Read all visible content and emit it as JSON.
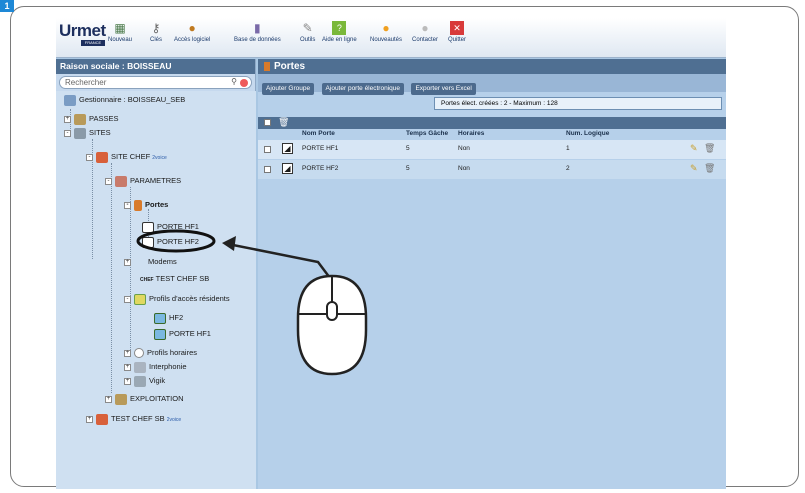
{
  "figure_label": "1",
  "logo": {
    "brand": "Urmet",
    "sub": "FRANCE"
  },
  "toolbar": [
    {
      "label": "Nouveau",
      "icon": "new-icon"
    },
    {
      "label": "Clés",
      "icon": "keys-icon"
    },
    {
      "label": "Accès logiciel",
      "icon": "users-icon"
    },
    {
      "label": "Base de données",
      "icon": "database-icon"
    },
    {
      "label": "Outils",
      "icon": "tools-icon"
    },
    {
      "label": "Aide en ligne",
      "icon": "help-icon"
    },
    {
      "label": "Nouveautés",
      "icon": "news-icon"
    },
    {
      "label": "Contacter",
      "icon": "contact-icon"
    },
    {
      "label": "Quitter",
      "icon": "quit-icon"
    }
  ],
  "sidebar": {
    "title": "Raison sociale : BOISSEAU",
    "search_placeholder": "Rechercher",
    "tree": [
      "Gestionnaire : BOISSEAU_SEB",
      "PASSES",
      "SITES",
      "SITE CHEF",
      "PARAMETRES",
      "Portes",
      "PORTE HF1",
      "PORTE HF2",
      "Modems",
      "TEST CHEF SB",
      "Profils d'accès résidents",
      "HF2",
      "PORTE HF1",
      "Profils horaires",
      "Interphonie",
      "Vigik",
      "EXPLOITATION",
      "TEST CHEF SB"
    ],
    "badge": "2voice",
    "chef_tag": "CHEF"
  },
  "main": {
    "title": "Portes",
    "buttons": [
      "Ajouter Groupe",
      "Ajouter porte électronique",
      "Exporter vers Excel"
    ],
    "info": "Portes élect. créées : 2 - Maximum : 128",
    "columns": [
      "Nom Porte",
      "Temps Gâche",
      "Horaires",
      "Num. Logique"
    ],
    "rows": [
      {
        "name": "PORTE HF1",
        "temps": "5",
        "horaires": "Non",
        "num": "1"
      },
      {
        "name": "PORTE HF2",
        "temps": "5",
        "horaires": "Non",
        "num": "2"
      }
    ]
  },
  "colors": {
    "header": "#4f6f92",
    "panel": "#b6d0ea",
    "highlight": "#1e88d6"
  }
}
